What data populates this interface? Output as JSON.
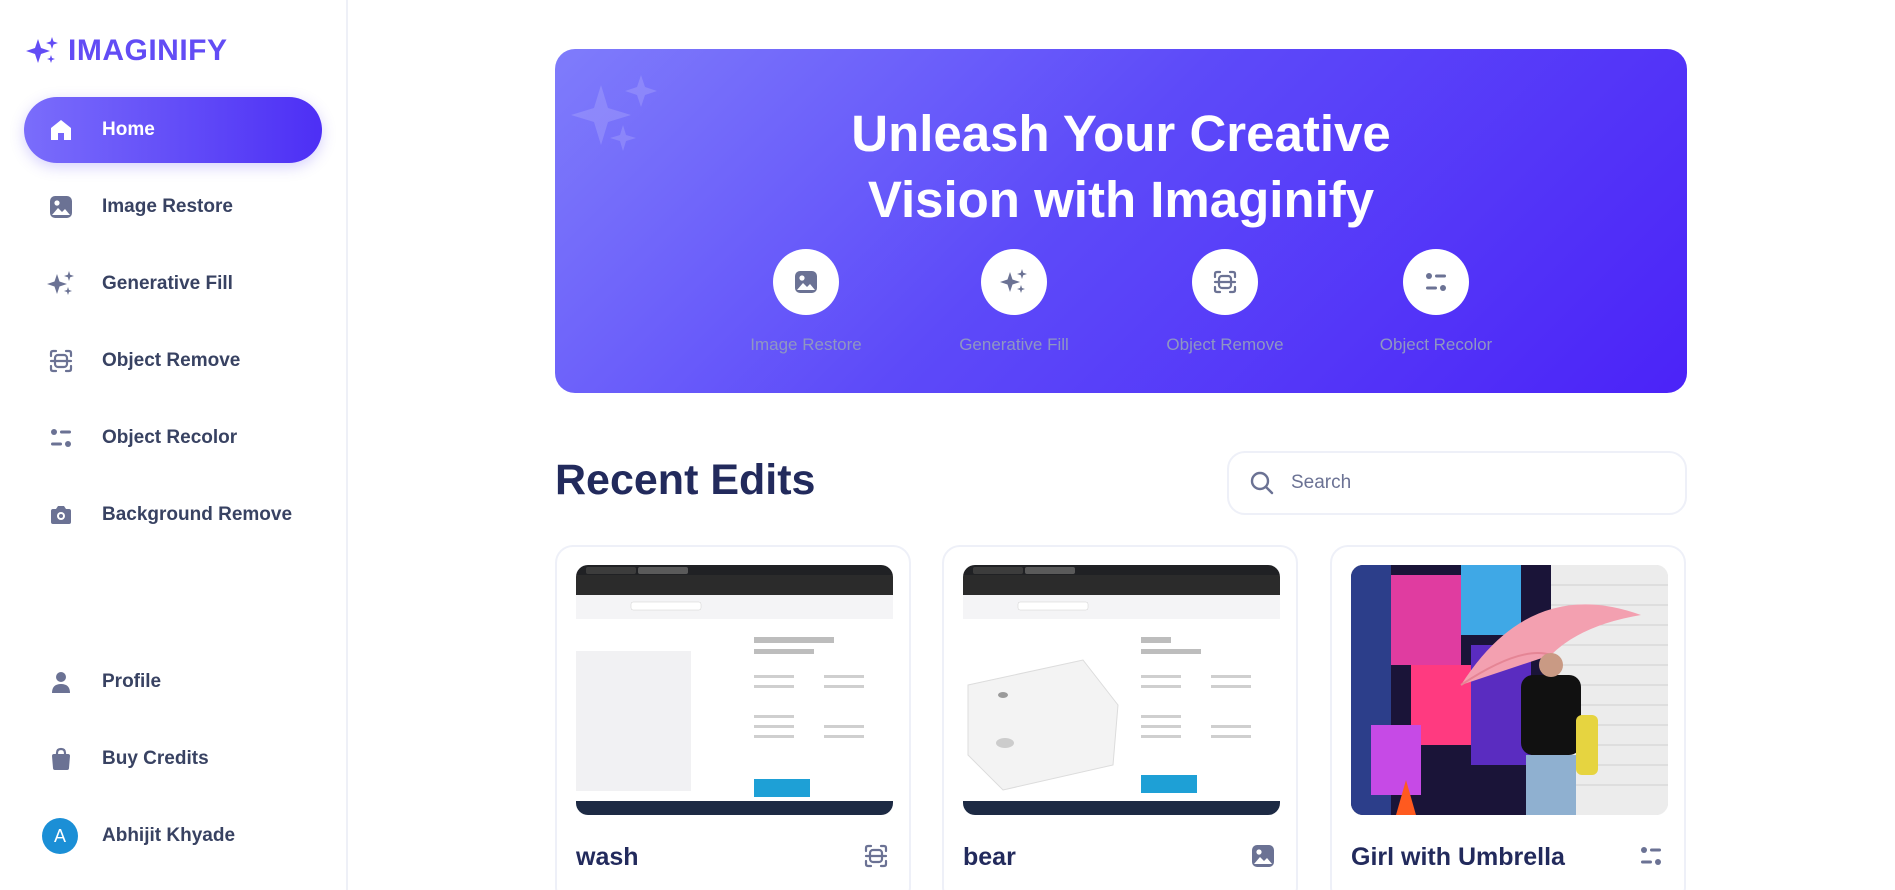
{
  "app": {
    "name": "IMAGINIFY"
  },
  "colors": {
    "brand": "#624cf5",
    "gradient_start": "#7f7cfb",
    "gradient_end": "#4b23f8",
    "text": "#384262",
    "heading": "#222a5c"
  },
  "sidebar": {
    "items": [
      {
        "label": "Home",
        "icon": "home-icon",
        "active": true
      },
      {
        "label": "Image Restore",
        "icon": "image-icon"
      },
      {
        "label": "Generative Fill",
        "icon": "sparkles-icon"
      },
      {
        "label": "Object Remove",
        "icon": "scan-icon"
      },
      {
        "label": "Object Recolor",
        "icon": "filter-icon"
      },
      {
        "label": "Background Remove",
        "icon": "camera-icon"
      }
    ],
    "bottom_items": [
      {
        "label": "Profile",
        "icon": "user-icon"
      },
      {
        "label": "Buy Credits",
        "icon": "bag-icon"
      }
    ],
    "user": {
      "initial": "A",
      "name": "Abhijit Khyade"
    }
  },
  "hero": {
    "title_line1": "Unleash Your Creative",
    "title_line2": "Vision with Imaginify",
    "features": [
      {
        "label": "Image Restore",
        "icon": "image-icon"
      },
      {
        "label": "Generative Fill",
        "icon": "sparkles-icon"
      },
      {
        "label": "Object Remove",
        "icon": "scan-icon"
      },
      {
        "label": "Object Recolor",
        "icon": "filter-icon"
      }
    ]
  },
  "recent": {
    "title": "Recent Edits",
    "search_placeholder": "Search",
    "cards": [
      {
        "title": "wash",
        "icon": "scan-icon"
      },
      {
        "title": "bear",
        "icon": "image-icon"
      },
      {
        "title": "Girl with Umbrella",
        "icon": "filter-icon"
      }
    ]
  }
}
